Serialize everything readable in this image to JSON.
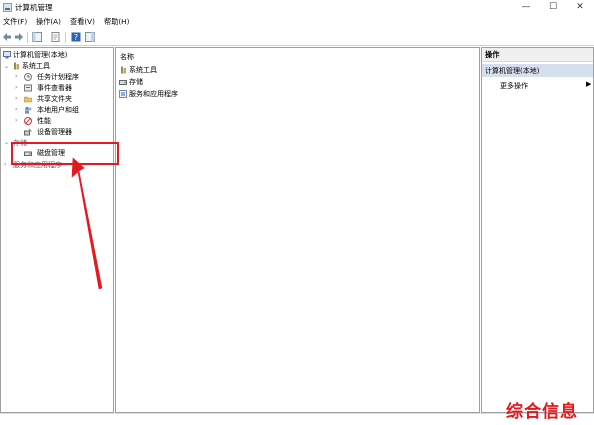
{
  "window": {
    "title": "计算机管理",
    "controls": {
      "minimize": "—",
      "maximize": "☐",
      "close": "✕"
    }
  },
  "menu": [
    "文件(F)",
    "操作(A)",
    "查看(V)",
    "帮助(H)"
  ],
  "left_tree": {
    "root": "计算机管理(本地)",
    "system_tools": "系统工具",
    "system_children": [
      "任务计划程序",
      "事件查看器",
      "共享文件夹",
      "本地用户和组",
      "性能",
      "设备管理器"
    ],
    "storage": "存储",
    "disk_management": "磁盘管理",
    "services": "服务和应用程序"
  },
  "middle": {
    "column_header": "名称",
    "items": [
      "系统工具",
      "存储",
      "服务和应用程序"
    ]
  },
  "actions": {
    "header": "操作",
    "group": "计算机管理(本地)",
    "item": "更多操作",
    "arrow": "▶"
  },
  "watermark": "综合信息",
  "colors": {
    "highlight": "#e21b23",
    "action_group_bg": "#d5e0ee",
    "watermark": "#e6161b"
  }
}
